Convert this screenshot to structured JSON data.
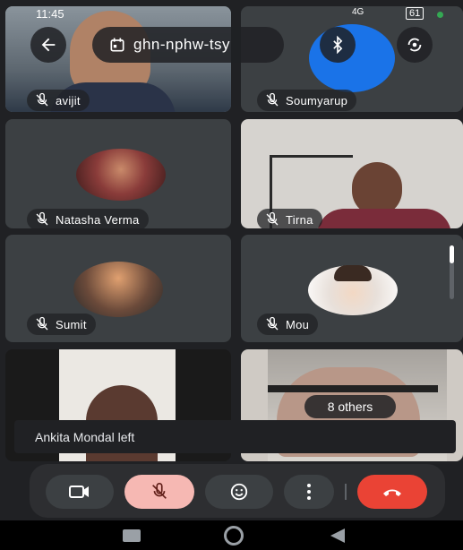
{
  "status": {
    "time": "11:45",
    "signal_label": "4G",
    "battery": "61"
  },
  "header": {
    "meeting_code": "ghn-nphw-tsy"
  },
  "participants": [
    {
      "name": "avijit"
    },
    {
      "name": "Soumyarup"
    },
    {
      "name": "Natasha Verma"
    },
    {
      "name": "Tirna"
    },
    {
      "name": "Sumit"
    },
    {
      "name": "Mou"
    }
  ],
  "others_label": "8 others",
  "toast": {
    "text": "Ankita Mondal left"
  },
  "colors": {
    "end_call": "#ea4335",
    "muted_mic_bg": "#f6b8b3",
    "tile_bg": "#3c4043"
  },
  "icons": [
    "back-arrow-icon",
    "calendar-icon",
    "bluetooth-icon",
    "switch-camera-icon",
    "mic-off-icon",
    "video-icon",
    "emoji-icon",
    "more-vert-icon",
    "end-call-icon",
    "recents-icon",
    "home-icon",
    "back-nav-icon"
  ]
}
